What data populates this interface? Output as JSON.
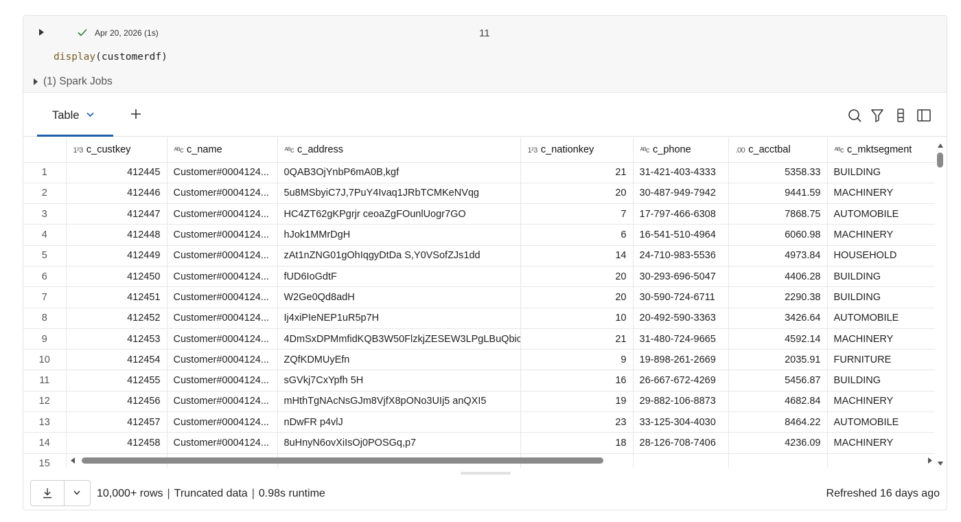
{
  "cell": {
    "run_meta": "Apr 20, 2026 (1s)",
    "cell_number": "11",
    "code_fn": "display",
    "code_args": "(customerdf)",
    "spark_jobs": "(1) Spark Jobs"
  },
  "toolbar": {
    "tab_label": "Table"
  },
  "table": {
    "columns": [
      {
        "type": "1²3",
        "name": "c_custkey"
      },
      {
        "type": "ᴬᴮc",
        "name": "c_name"
      },
      {
        "type": "ᴬᴮc",
        "name": "c_address"
      },
      {
        "type": "1²3",
        "name": "c_nationkey"
      },
      {
        "type": "ᴬᴮc",
        "name": "c_phone"
      },
      {
        "type": ".00",
        "name": "c_acctbal"
      },
      {
        "type": "ᴬᴮc",
        "name": "c_mktsegment"
      }
    ],
    "rows": [
      [
        "1",
        "412445",
        "Customer#0004124...",
        "0QAB3OjYnbP6mA0B,kgf",
        "21",
        "31-421-403-4333",
        "5358.33",
        "BUILDING"
      ],
      [
        "2",
        "412446",
        "Customer#0004124...",
        "5u8MSbyiC7J,7PuY4Ivaq1JRbTCMKeNVqg",
        "20",
        "30-487-949-7942",
        "9441.59",
        "MACHINERY"
      ],
      [
        "3",
        "412447",
        "Customer#0004124...",
        "HC4ZT62gKPgrjr ceoaZgFOunlUogr7GO",
        "7",
        "17-797-466-6308",
        "7868.75",
        "AUTOMOBILE"
      ],
      [
        "4",
        "412448",
        "Customer#0004124...",
        "hJok1MMrDgH",
        "6",
        "16-541-510-4964",
        "6060.98",
        "MACHINERY"
      ],
      [
        "5",
        "412449",
        "Customer#0004124...",
        "zAt1nZNG01gOhIqgyDtDa S,Y0VSofZJs1dd",
        "14",
        "24-710-983-5536",
        "4973.84",
        "HOUSEHOLD"
      ],
      [
        "6",
        "412450",
        "Customer#0004124...",
        "fUD6IoGdtF",
        "20",
        "30-293-696-5047",
        "4406.28",
        "BUILDING"
      ],
      [
        "7",
        "412451",
        "Customer#0004124...",
        "W2Ge0Qd8adH",
        "20",
        "30-590-724-6711",
        "2290.38",
        "BUILDING"
      ],
      [
        "8",
        "412452",
        "Customer#0004124...",
        "Ij4xiPIeNEP1uR5p7H",
        "10",
        "20-492-590-3363",
        "3426.64",
        "AUTOMOBILE"
      ],
      [
        "9",
        "412453",
        "Customer#0004124...",
        "4DmSxDPMmfidKQB3W50FlzkjZESEW3LPgLBuQbic",
        "21",
        "31-480-724-9665",
        "4592.14",
        "MACHINERY"
      ],
      [
        "10",
        "412454",
        "Customer#0004124...",
        "ZQfKDMUyEfn",
        "9",
        "19-898-261-2669",
        "2035.91",
        "FURNITURE"
      ],
      [
        "11",
        "412455",
        "Customer#0004124...",
        "sGVkj7CxYpfh 5H",
        "16",
        "26-667-672-4269",
        "5456.87",
        "BUILDING"
      ],
      [
        "12",
        "412456",
        "Customer#0004124...",
        "mHthTgNAcNsGJm8VjfX8pONo3UIj5 anQXI5",
        "19",
        "29-882-106-8873",
        "4682.84",
        "MACHINERY"
      ],
      [
        "13",
        "412457",
        "Customer#0004124...",
        "nDwFR p4vlJ",
        "23",
        "33-125-304-4030",
        "8464.22",
        "AUTOMOBILE"
      ],
      [
        "14",
        "412458",
        "Customer#0004124...",
        "8uHnyN6ovXiIsOj0POSGq,p7",
        "18",
        "28-126-708-7406",
        "4236.09",
        "MACHINERY"
      ],
      [
        "15",
        "",
        "",
        "",
        "",
        "",
        "",
        ""
      ]
    ]
  },
  "footer": {
    "rows": "10,000+ rows",
    "truncated": "Truncated data",
    "runtime": "0.98s runtime",
    "refreshed": "Refreshed 16 days ago"
  }
}
